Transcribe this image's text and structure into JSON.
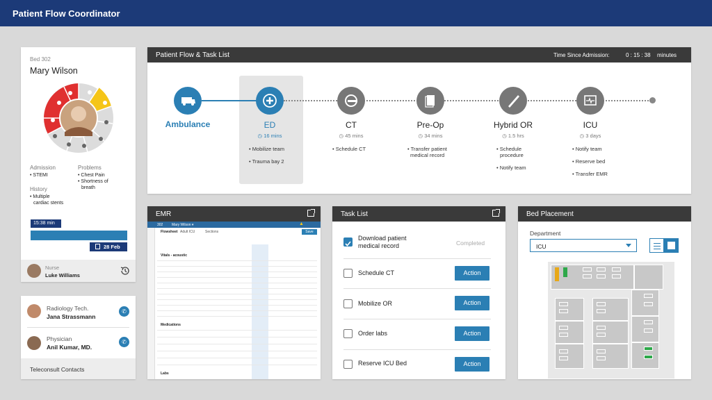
{
  "app": {
    "title": "Patient Flow Coordinator"
  },
  "patient": {
    "bed": "Bed 302",
    "name": "Mary Wilson",
    "admission_label": "Admission",
    "admission_value": "• STEMI",
    "problems_label": "Problems",
    "problems": [
      "• Chest Pain",
      "• Shortness of",
      "breath"
    ],
    "history_label": "History",
    "history": [
      "• Multiple",
      "cardiac stents"
    ],
    "timeline_start": "15:38 min",
    "timeline_date": "28 Feb",
    "nurse_role": "Nurse",
    "nurse_name": "Luke Williams"
  },
  "contacts": {
    "items": [
      {
        "role": "Radiology Tech.",
        "name": "Jana Strassmann"
      },
      {
        "role": "Physician",
        "name": "Anil Kumar, MD."
      }
    ],
    "footer": "Teleconsult Contacts"
  },
  "flow": {
    "title": "Patient Flow & Task List",
    "time_label": "Time Since Admission:",
    "time_value": "0 : 15 : 38",
    "time_unit": "minutes",
    "stages": [
      {
        "name": "Ambulance",
        "time": "",
        "tasks": []
      },
      {
        "name": "ED",
        "time": "16 mins",
        "tasks": [
          "• Mobilize team",
          "• Trauma bay 2"
        ]
      },
      {
        "name": "CT",
        "time": "45 mins",
        "tasks": [
          "• Schedule CT"
        ]
      },
      {
        "name": "Pre-Op",
        "time": "34 mins",
        "tasks": [
          "• Transfer patient",
          "medical record"
        ]
      },
      {
        "name": "Hybrid OR",
        "time": "1.5 hrs",
        "tasks": [
          "• Schedule",
          "procedure",
          "• Notify team"
        ]
      },
      {
        "name": "ICU",
        "time": "3 days",
        "tasks": [
          "• Notify team",
          "• Reserve bed",
          "• Transfer EMR"
        ]
      }
    ]
  },
  "emr": {
    "title": "EMR",
    "bed": "302",
    "patient": "Mary Wilson ▾",
    "tab1": "Flowsheet",
    "tab2": "Adult ICU",
    "tab3": "Sections",
    "save": "Save",
    "section_vitals": "Vitals - acoustic",
    "section_meds": "Medications",
    "section_labs": "Labs"
  },
  "tasks": {
    "title": "Task List",
    "items": [
      {
        "label": "Download patient medical record",
        "status": "Completed",
        "done": true
      },
      {
        "label": "Schedule CT",
        "action": "Action",
        "done": false
      },
      {
        "label": "Mobilize OR",
        "action": "Action",
        "done": false
      },
      {
        "label": "Order labs",
        "action": "Action",
        "done": false
      },
      {
        "label": "Reserve ICU Bed",
        "action": "Action",
        "done": false
      }
    ]
  },
  "beds": {
    "title": "Bed Placement",
    "department_label": "Department",
    "department_value": "ICU"
  },
  "colors": {
    "brand": "#1c3a78",
    "accent": "#2b7fb4",
    "problem_red": "#e03030",
    "yellow": "#f5c518"
  }
}
